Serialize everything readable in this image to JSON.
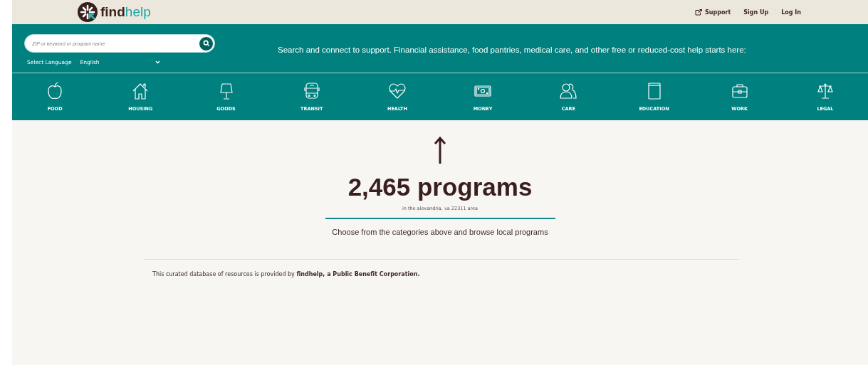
{
  "header": {
    "logo": {
      "dark_part": "find",
      "accent_part": "help"
    },
    "links": [
      {
        "label": "Support",
        "kind": "external"
      },
      {
        "label": "Sign Up",
        "kind": "plain"
      },
      {
        "label": "Log In",
        "kind": "plain"
      }
    ]
  },
  "search": {
    "placeholder": "ZIP or keyword or program name",
    "language_label": "Select Language",
    "language_value": "English",
    "tagline": "Search and connect to support. Financial assistance, food pantries, medical care, and other free or reduced-cost help starts here:"
  },
  "categories": [
    {
      "label": "FOOD",
      "kind": "apple"
    },
    {
      "label": "HOUSING",
      "kind": "house"
    },
    {
      "label": "GOODS",
      "kind": "lamp"
    },
    {
      "label": "TRANSIT",
      "kind": "bus"
    },
    {
      "label": "HEALTH",
      "kind": "heart"
    },
    {
      "label": "MONEY",
      "kind": "money"
    },
    {
      "label": "CARE",
      "kind": "people"
    },
    {
      "label": "EDUCATION",
      "kind": "book"
    },
    {
      "label": "WORK",
      "kind": "briefcase"
    },
    {
      "label": "LEGAL",
      "kind": "scales"
    }
  ],
  "results": {
    "count": "2,465 programs",
    "area": "in the alexandria, va 22311 area",
    "hint": "Choose from the categories above and browse local programs"
  },
  "footer": {
    "text": "This curated database of resources is provided by **findhelp, a Public Benefit Corporation.**"
  }
}
